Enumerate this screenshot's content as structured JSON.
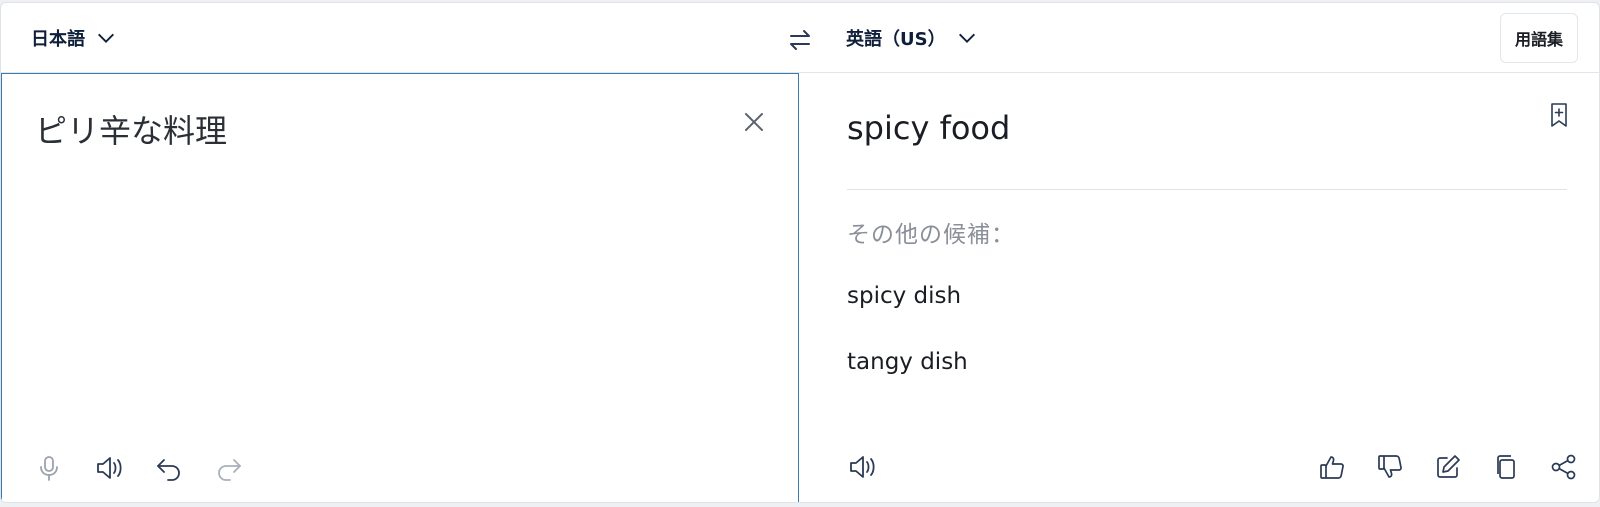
{
  "header": {
    "source_language": "日本語",
    "target_language": "英語（US）",
    "glossary_label": "用語集"
  },
  "source": {
    "text": "ピリ辛な料理"
  },
  "target": {
    "translation": "spicy food",
    "alternatives_heading": "その他の候補：",
    "alternatives": [
      "spicy dish",
      "tangy dish"
    ]
  },
  "icons": {
    "source_toolbar": [
      "microphone-icon",
      "speaker-icon",
      "undo-icon",
      "redo-icon"
    ],
    "target_toolbar": [
      "thumbs-up-icon",
      "thumbs-down-icon",
      "edit-icon",
      "copy-icon",
      "share-icon"
    ]
  },
  "colors": {
    "accent_border": "#3b7bb0",
    "text_dark": "#0f1f3a",
    "muted": "#8a9099"
  }
}
